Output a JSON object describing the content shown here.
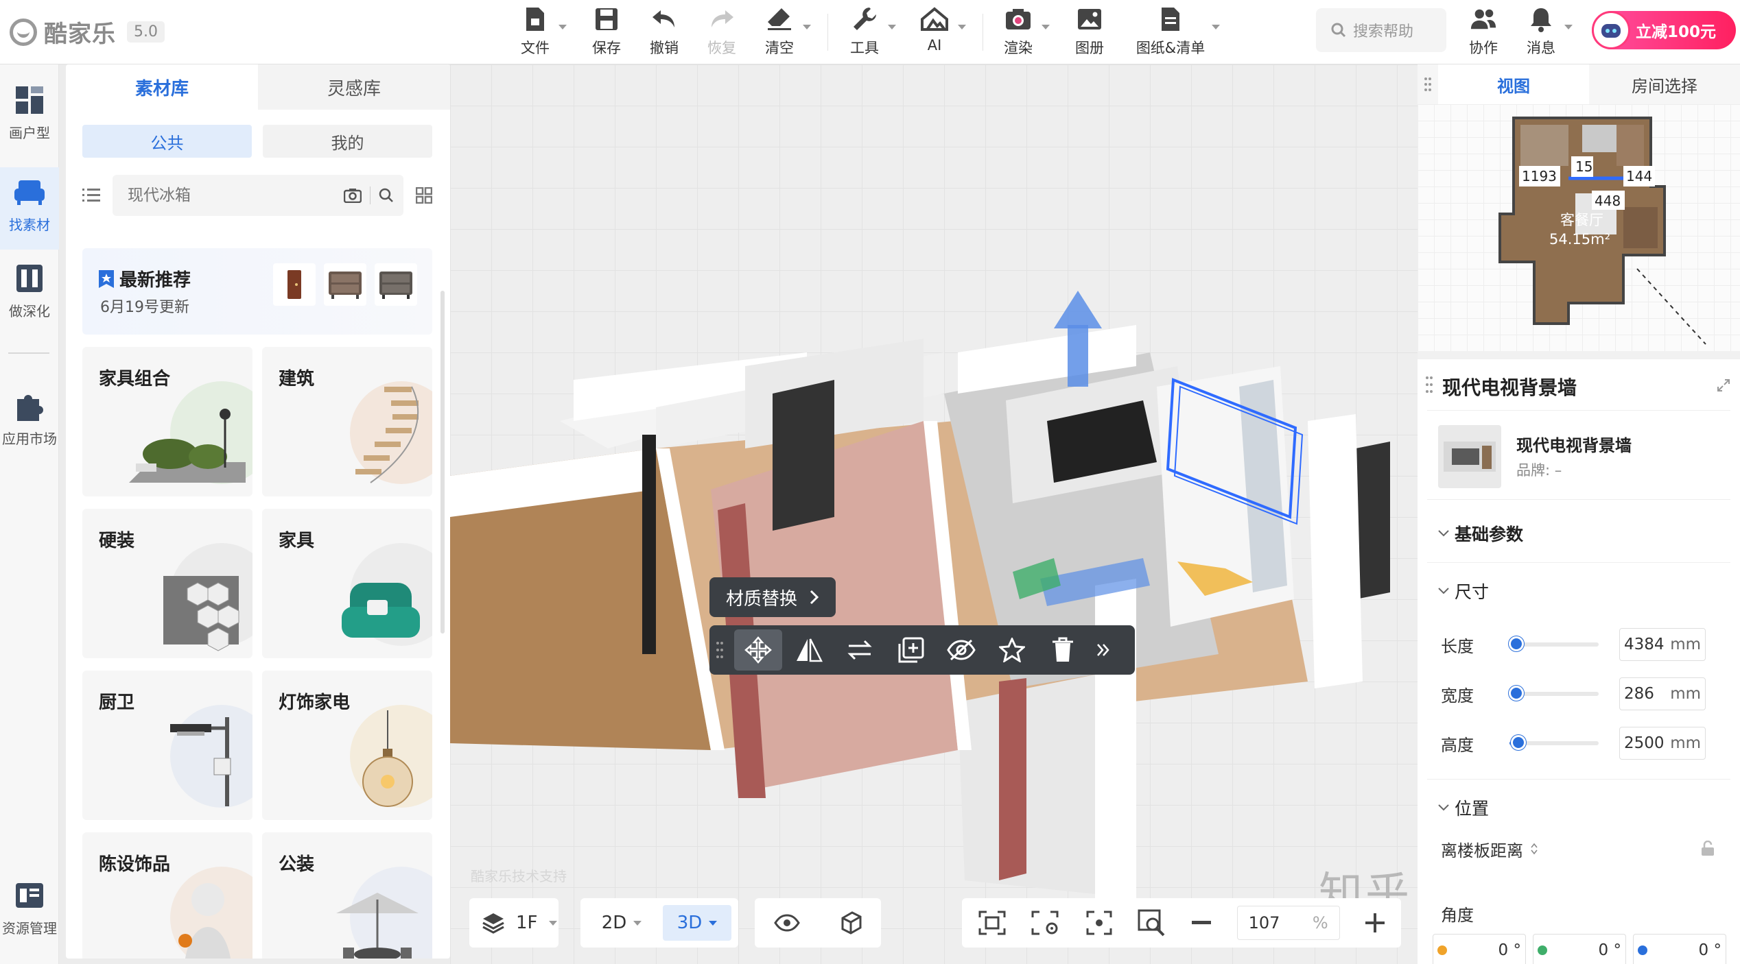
{
  "app": {
    "logo_text": "酷家乐",
    "version": "5.0"
  },
  "toolbar": {
    "file": "文件",
    "save": "保存",
    "undo": "撤销",
    "redo": "恢复",
    "clear": "清空",
    "tools": "工具",
    "ai": "AI",
    "render": "渲染",
    "album": "图册",
    "drawings": "图纸&清单",
    "search_help": "搜索帮助",
    "collab": "协作",
    "messages": "消息",
    "promo": "立减100元"
  },
  "leftnav": {
    "floorplan": "画户型",
    "find_material": "找素材",
    "deepen": "做深化",
    "app_market": "应用市场",
    "resource_mgmt": "资源管理"
  },
  "material_panel": {
    "tabs": [
      "素材库",
      "灵感库"
    ],
    "sub_tabs": [
      "公共",
      "我的"
    ],
    "search_placeholder": "现代冰箱",
    "recommend": {
      "title": "最新推荐",
      "subtitle": "6月19号更新"
    },
    "categories": [
      "家具组合",
      "建筑",
      "硬装",
      "家具",
      "厨卫",
      "灯饰家电",
      "陈设饰品",
      "公装"
    ]
  },
  "viewport": {
    "material_replace": "材质替换",
    "watermark_small": "酷家乐技术支持",
    "watermark_big": "知乎 @工具宝箱",
    "floor": "1F",
    "mode_2d": "2D",
    "mode_3d": "3D",
    "zoom_value": "107",
    "zoom_unit": "%"
  },
  "right_panel": {
    "tabs": [
      "视图",
      "房间选择"
    ],
    "minimap": {
      "room_name": "客餐厅",
      "room_area": "54.15m²",
      "dims": [
        "15",
        "1193",
        "144",
        "448"
      ]
    },
    "object_title": "现代电视背景墙",
    "product": {
      "name": "现代电视背景墙",
      "brand": "品牌: –"
    },
    "basic_params": "基础参数",
    "size_section": "尺寸",
    "length": {
      "label": "长度",
      "value": "4384",
      "unit": "mm",
      "level": 0.08
    },
    "width": {
      "label": "宽度",
      "value": "286",
      "unit": "mm",
      "level": 0.08
    },
    "height": {
      "label": "高度",
      "value": "2500",
      "unit": "mm",
      "level": 0.1
    },
    "position_section": "位置",
    "floor_distance": "离楼板距离",
    "angle": "角度",
    "angle_values": [
      "0 °",
      "0 °",
      "0 °"
    ]
  },
  "colors": {
    "accent": "#2a6fdb",
    "promo": "#ff2a6a",
    "selection": "#2f6bff"
  }
}
